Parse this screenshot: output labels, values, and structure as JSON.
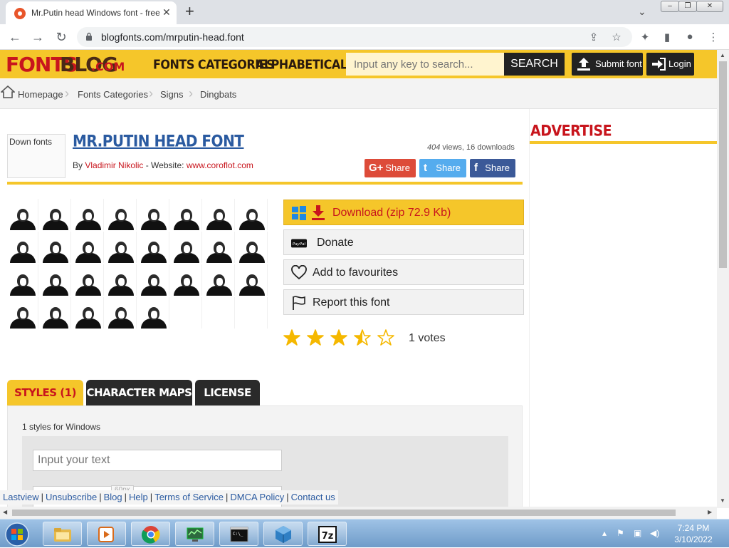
{
  "browser": {
    "tab_title": "Mr.Putin head Windows font - free for Personal",
    "tab_close": "✕",
    "new_tab": "+",
    "url": "blogfonts.com/mrputin-head.font",
    "window_controls": [
      "minimize",
      "restore",
      "close"
    ]
  },
  "site": {
    "logo": {
      "part1": "FONTS",
      "part2": "BLOG",
      "part3": ".COM"
    },
    "nav": [
      "FONTS CATEGORIES",
      "ALPHABETICALLY"
    ],
    "search_placeholder": "Input any key to search...",
    "search_button": "SEARCH",
    "submit_button": "Submit font",
    "login_button": "Login",
    "brand_color": "#f5c62a",
    "accent_color": "#c8151d"
  },
  "breadcrumb": [
    "Homepage",
    "Fonts Categories",
    "Signs",
    "Dingbats"
  ],
  "font": {
    "thumb_alt": "Down fonts",
    "title": "MR.PUTIN HEAD FONT",
    "by_label": "By",
    "author": "Vladimir Nikolic",
    "website_label": "- Website:",
    "website": "www.coroflot.com",
    "views": "404",
    "stats_rest": "views, 16 downloads",
    "share": [
      {
        "icon": "G+",
        "label": "Share",
        "color": "#dd4b39"
      },
      {
        "icon": "t",
        "label": "Share",
        "color": "#55acee"
      },
      {
        "icon": "f",
        "label": "Share",
        "color": "#3b5998"
      }
    ]
  },
  "actions": {
    "download": "Download (zip 72.9 Kb)",
    "donate": "Donate",
    "favourites": "Add to favourites",
    "report": "Report this font"
  },
  "rating": {
    "stars": 3.5,
    "max": 5,
    "votes_text": "1 votes"
  },
  "tabs": [
    "STYLES (1)",
    "CHARACTER MAPS",
    "LICENSE"
  ],
  "styles_panel": {
    "count_text": "1 styles for Windows",
    "text_placeholder": "Input your text",
    "size_tag": "60px"
  },
  "sidebar": {
    "advertise": "ADVERTISE"
  },
  "footer_links": [
    "Lastview",
    "Unsubscribe",
    "Blog",
    "Help",
    "Terms of Service",
    "DMCA Policy",
    "Contact us"
  ],
  "taskbar": {
    "apps": [
      "file-explorer",
      "media-player",
      "chrome",
      "network-tool",
      "command-prompt",
      "virtualbox",
      "7-zip"
    ],
    "time": "7:24 PM",
    "date": "3/10/2022"
  }
}
